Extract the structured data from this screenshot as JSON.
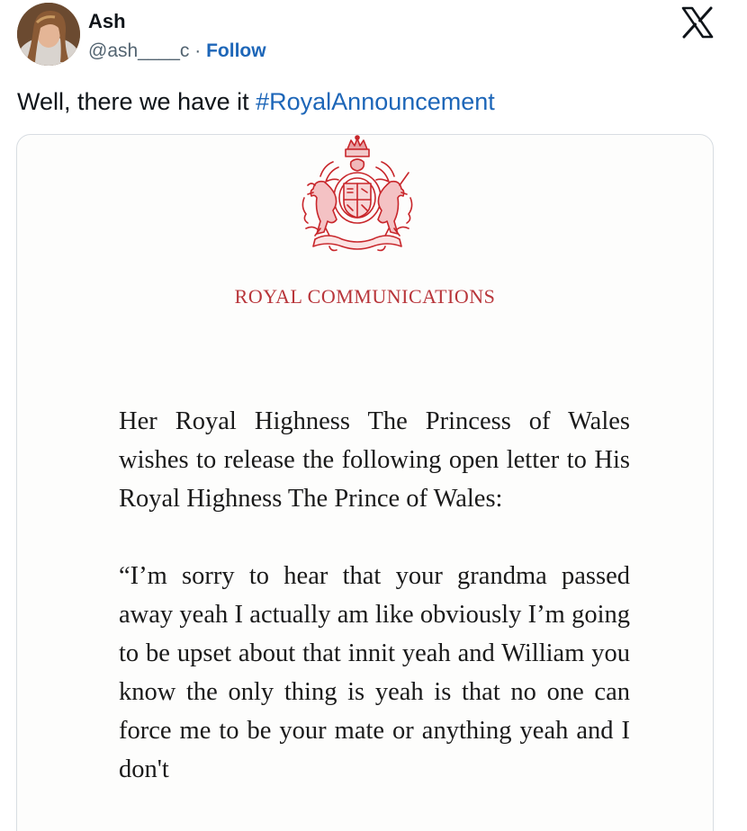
{
  "tweet": {
    "author": {
      "name": "Ash",
      "handle": "@ash____c",
      "separator": "·",
      "follow_label": "Follow"
    },
    "platform_icon": "x-logo-icon",
    "text_prefix": "Well, there we have it ",
    "hashtag": "#RoyalAnnouncement"
  },
  "media": {
    "crest_icon": "royal-coat-of-arms-icon",
    "heading": "ROYAL COMMUNICATIONS",
    "intro": "Her Royal Highness The Princess of Wales wishes to release the following open letter to His Royal Highness The Prince of Wales:",
    "quote": "“I’m sorry to hear that your grandma passed away yeah I actually am like obviously I’m going to be upset about that innit yeah and William you know the only thing is yeah is that no one can force me to be your mate or anything yeah and I don't"
  },
  "colors": {
    "link": "#1d66b8",
    "crest_red": "#c8262b",
    "heading_red": "#b8353a",
    "text": "#0f1419",
    "muted": "#536471"
  }
}
